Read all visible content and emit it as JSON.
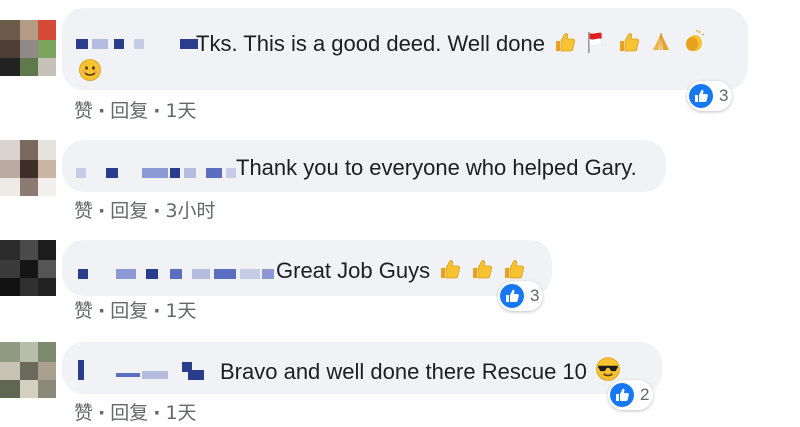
{
  "comments": [
    {
      "text": "Tks. This is a good deed. Well done",
      "emoji_icons": [
        "thumbs-up-icon",
        "indonesia-flag-icon",
        "thumbs-up-icon",
        "folded-hands-icon",
        "clapping-hands-icon",
        "smiling-face-icon"
      ],
      "actions": {
        "like": "赞",
        "reply": "回复",
        "time": "1天"
      },
      "reactions": {
        "icon": "like-icon",
        "count": "3"
      }
    },
    {
      "text": "Thank you to everyone who helped Gary.",
      "actions": {
        "like": "赞",
        "reply": "回复",
        "time": "3小时"
      }
    },
    {
      "text": "Great Job Guys",
      "emoji_icons": [
        "thumbs-up-icon",
        "thumbs-up-icon",
        "thumbs-up-icon"
      ],
      "actions": {
        "like": "赞",
        "reply": "回复",
        "time": "1天"
      },
      "reactions": {
        "icon": "like-icon",
        "count": "3"
      }
    },
    {
      "text": "Bravo and well done there Rescue 10",
      "emoji_icons": [
        "sunglasses-face-icon"
      ],
      "actions": {
        "like": "赞",
        "reply": "回复",
        "time": "1天"
      },
      "reactions": {
        "icon": "like-icon",
        "count": "2"
      }
    }
  ],
  "colors": {
    "bubble": "#f0f2f5",
    "action_text": "#65676b",
    "like_blue": "#1877f2",
    "blur_blue": "#2a3c8c"
  }
}
